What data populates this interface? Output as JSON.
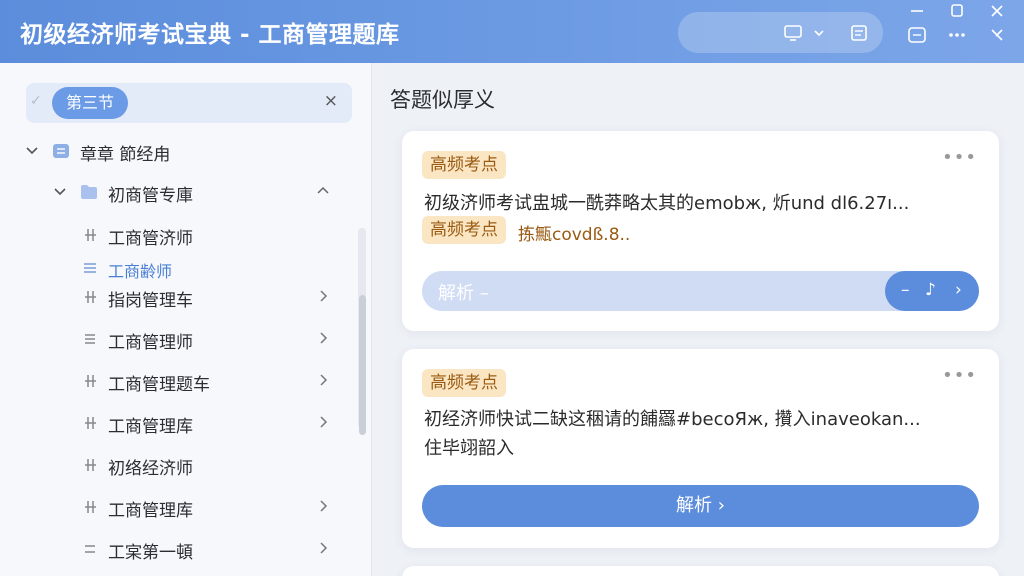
{
  "header": {
    "title": "初级经济师考试宝典 - 工商管理题库"
  },
  "sidebar": {
    "search_chip": "第三节",
    "clear_icon": "×",
    "items": [
      {
        "label": "章章  節经甪",
        "icon": "list-box-icon",
        "level": 0,
        "expanded": true
      },
      {
        "label": "初商管专庫",
        "icon": "folder-icon",
        "level": 1,
        "expanded": true
      },
      {
        "label": "工商管济师",
        "icon": "quiz-icon",
        "level": 2
      },
      {
        "label": "工商齢师",
        "icon": "lines-icon",
        "level": 2,
        "active": true
      },
      {
        "label": "指岗管理车",
        "icon": "quiz-icon",
        "level": 2
      },
      {
        "label": "工商管理师",
        "icon": "lines-icon",
        "level": 2
      },
      {
        "label": "工商管理题车",
        "icon": "quiz-icon",
        "level": 2
      },
      {
        "label": "工商管理库",
        "icon": "quiz-icon",
        "level": 2
      },
      {
        "label": "初络经济师",
        "icon": "quiz-icon",
        "level": 2
      },
      {
        "label": "工商管理库",
        "icon": "quiz-icon",
        "level": 2
      },
      {
        "label": "工宲第一頓",
        "icon": "lines-icon",
        "level": 2
      }
    ]
  },
  "main": {
    "title": "答题似厚义",
    "cards": [
      {
        "badge": "高频考点",
        "text": "初级济师考试盅城一酰莽略太其的emobж, 炘und dl6.27ı...",
        "badge2": "高频考点",
        "text2": "拣甒covdß.8..",
        "analysis_label": "解析 –",
        "analysis_controls": [
          "–",
          "♪",
          "›"
        ],
        "more": "•••"
      },
      {
        "badge": "高频考点",
        "text": "初经济师快试二缺这稇请的餔羉#becoЯж, 攢入inaveokan...",
        "text2": "住毕翊韶入",
        "analysis_button": "解析 ›",
        "more": "•••"
      }
    ]
  },
  "colors": {
    "accent": "#5b8ddc",
    "badge_bg": "#fbe6c4",
    "badge_text": "#9a5a12"
  }
}
